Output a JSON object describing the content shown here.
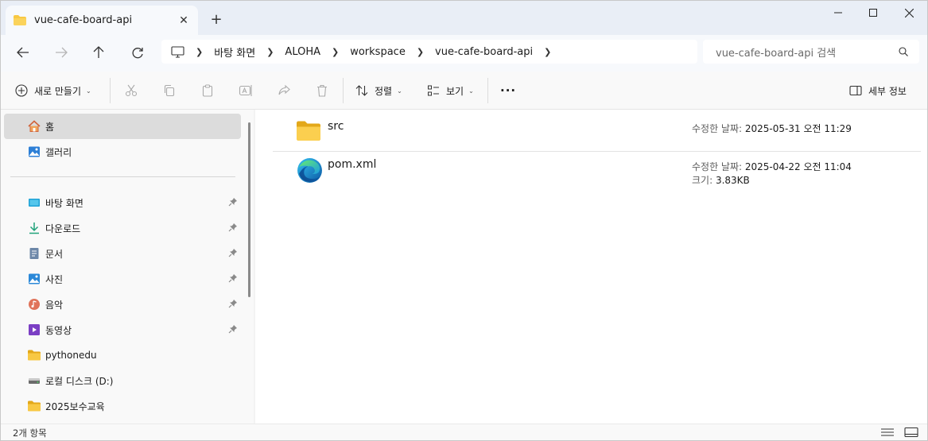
{
  "window": {
    "tab_title": "vue-cafe-board-api",
    "tab_close": "✕",
    "new_tab": "+",
    "minimize": "—",
    "maximize": "☐",
    "close": "✕"
  },
  "address": {
    "breadcrumbs": [
      "바탕 화면",
      "ALOHA",
      "workspace",
      "vue-cafe-board-api"
    ],
    "search_placeholder": "vue-cafe-board-api 검색"
  },
  "toolbar": {
    "new_label": "새로 만들기",
    "sort_label": "정렬",
    "view_label": "보기",
    "more_label": "···",
    "details_label": "세부 정보"
  },
  "sidebar": {
    "quick": [
      {
        "label": "홈",
        "icon": "home-icon"
      },
      {
        "label": "갤러리",
        "icon": "gallery-icon"
      }
    ],
    "items": [
      {
        "label": "바탕 화면",
        "icon": "desktop-icon",
        "pinned": true
      },
      {
        "label": "다운로드",
        "icon": "download-icon",
        "pinned": true
      },
      {
        "label": "문서",
        "icon": "document-icon",
        "pinned": true
      },
      {
        "label": "사진",
        "icon": "pictures-icon",
        "pinned": true
      },
      {
        "label": "음악",
        "icon": "music-icon",
        "pinned": true
      },
      {
        "label": "동영상",
        "icon": "video-icon",
        "pinned": true
      },
      {
        "label": "pythonedu",
        "icon": "folder-icon",
        "pinned": false
      },
      {
        "label": "로컬 디스크 (D:)",
        "icon": "drive-icon",
        "pinned": false
      },
      {
        "label": "2025보수교육",
        "icon": "folder-icon",
        "pinned": false
      }
    ]
  },
  "files": [
    {
      "name": "src",
      "icon": "folder-icon",
      "modified_label": "수정한 날짜:",
      "modified": "2025-05-31 오전 11:29",
      "size_label": "",
      "size": ""
    },
    {
      "name": "pom.xml",
      "icon": "edge-icon",
      "modified_label": "수정한 날짜:",
      "modified": "2025-04-22 오전 11:04",
      "size_label": "크기:",
      "size": "3.83KB"
    }
  ],
  "status": {
    "item_count": "2개 항목"
  },
  "colors": {
    "folder": "#f8c843",
    "folder_dark": "#e3a81a",
    "selected": "#dcdcdc",
    "accent": "#0067c0"
  }
}
